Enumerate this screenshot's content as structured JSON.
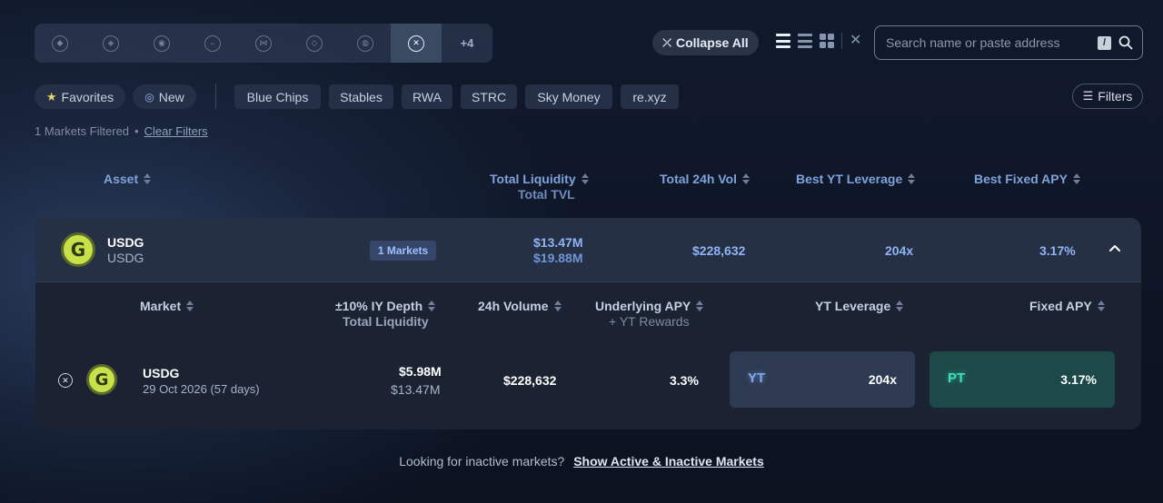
{
  "chains": {
    "icons": [
      "ethereum-icon",
      "arbitrum-icon",
      "optimism-icon",
      "chain-icon-4",
      "chain-icon-5",
      "bnb-icon",
      "chain-icon-7",
      "selected-chain-icon"
    ],
    "more_label": "+4"
  },
  "toolbar": {
    "collapse_label": "Collapse All",
    "search_placeholder": "Search name or paste address",
    "search_shortcut": "/"
  },
  "filters": {
    "favorites": "Favorites",
    "new": "New",
    "tags": [
      "Blue Chips",
      "Stables",
      "RWA",
      "STRC",
      "Sky Money",
      "re.xyz"
    ],
    "filters_button": "Filters",
    "filtered_count": "1 Markets Filtered",
    "clear_label": "Clear Filters"
  },
  "table_headers": {
    "asset": "Asset",
    "total_liquidity": "Total Liquidity",
    "total_tvl": "Total TVL",
    "total_24h_vol": "Total 24h Vol",
    "best_yt_leverage": "Best YT Leverage",
    "best_fixed_apy": "Best Fixed APY"
  },
  "asset_row": {
    "name": "USDG",
    "sub": "USDG",
    "markets_badge": "1 Markets",
    "liquidity": "$13.47M",
    "tvl": "$19.88M",
    "volume": "$228,632",
    "yt_leverage": "204x",
    "fixed_apy": "3.17%"
  },
  "market_headers": {
    "market": "Market",
    "iy_depth": "±10% IY Depth",
    "total_liquidity": "Total Liquidity",
    "volume": "24h Volume",
    "underlying_apy": "Underlying APY",
    "yt_rewards": "+ YT Rewards",
    "yt_leverage": "YT Leverage",
    "fixed_apy": "Fixed APY"
  },
  "market_row": {
    "name": "USDG",
    "expiry": "29 Oct 2026 (57 days)",
    "depth": "$5.98M",
    "liquidity": "$13.47M",
    "volume": "$228,632",
    "underlying_apy": "3.3%",
    "yt_label": "YT",
    "yt_value": "204x",
    "pt_label": "PT",
    "pt_value": "3.17%"
  },
  "footer": {
    "question": "Looking for inactive markets?",
    "link": "Show Active & Inactive Markets"
  },
  "colors": {
    "accent_blue": "#8fb4f5",
    "yt_box": "#2d3a52",
    "pt_box": "#1d4a48",
    "pt_text": "#3fe0b8",
    "yt_text": "#7fa8f0",
    "usdg_brand": "#c8e04a"
  }
}
